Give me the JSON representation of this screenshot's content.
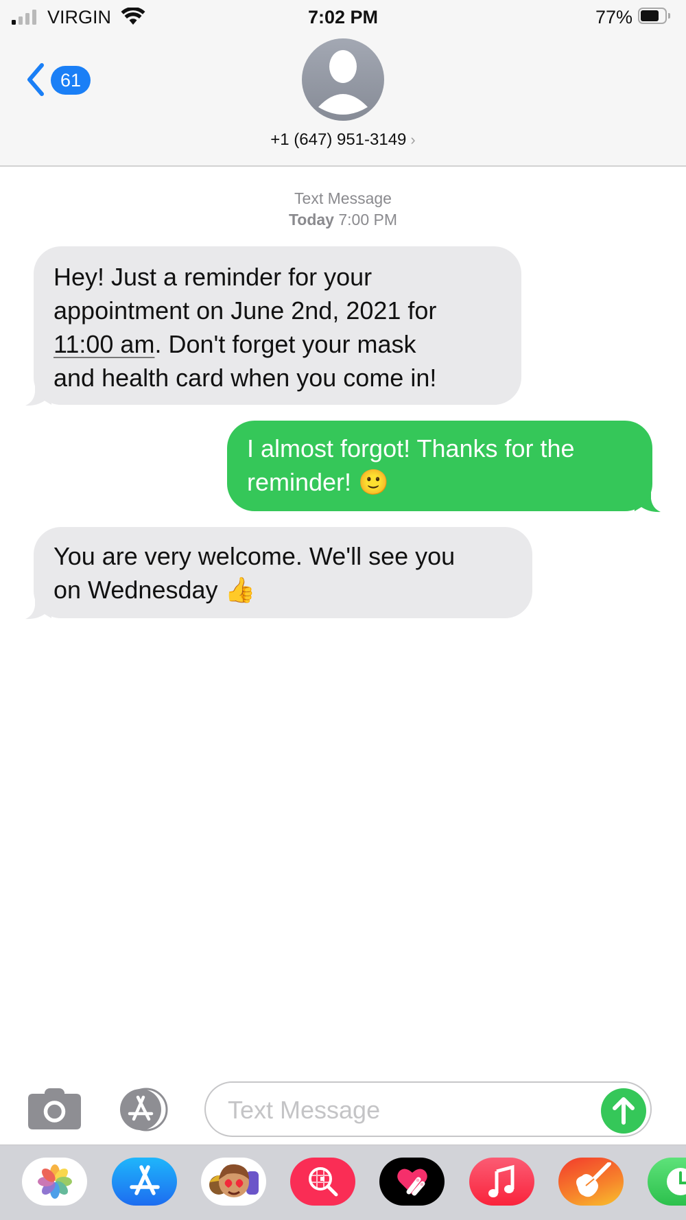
{
  "status_bar": {
    "carrier": "VIRGIN",
    "time": "7:02 PM",
    "battery_percent": "77%",
    "signal_bars_filled": 1,
    "signal_bars_total": 4,
    "battery_level": 0.77
  },
  "nav": {
    "back_badge_count": "61",
    "contact": "+1 (647) 951-3149",
    "contact_chevron": "›"
  },
  "conversation": {
    "service_label": "Text Message",
    "timestamp_day": "Today",
    "timestamp_time": "7:00 PM",
    "messages": [
      {
        "direction": "incoming",
        "lines": [
          "Hey! Just a reminder for your",
          "appointment on June 2nd, 2021 for",
          "11:00 am",
          ". Don't forget your mask",
          "and health card when you come in!"
        ]
      },
      {
        "direction": "outgoing",
        "lines": [
          "I almost forgot! Thanks for the",
          "reminder! 🙂"
        ]
      },
      {
        "direction": "incoming",
        "lines": [
          "You are very welcome. We'll see you",
          "on Wednesday 👍"
        ]
      }
    ]
  },
  "composer": {
    "placeholder": "Text Message",
    "value": ""
  },
  "app_drawer": {
    "apps": [
      {
        "name": "Photos",
        "icon": "photos-icon"
      },
      {
        "name": "App Store",
        "icon": "app-store-icon"
      },
      {
        "name": "Memoji Stickers",
        "icon": "memoji-icon"
      },
      {
        "name": "#images",
        "icon": "image-search-icon"
      },
      {
        "name": "Digital Touch",
        "icon": "digital-touch-icon"
      },
      {
        "name": "Music",
        "icon": "music-icon"
      },
      {
        "name": "GarageBand",
        "icon": "garageband-icon"
      },
      {
        "name": "Screen Time",
        "icon": "clock-icon"
      }
    ]
  },
  "colors": {
    "accent_blue": "#1a7ff6",
    "sms_green": "#35c759",
    "incoming_bubble": "#e9e9eb"
  }
}
